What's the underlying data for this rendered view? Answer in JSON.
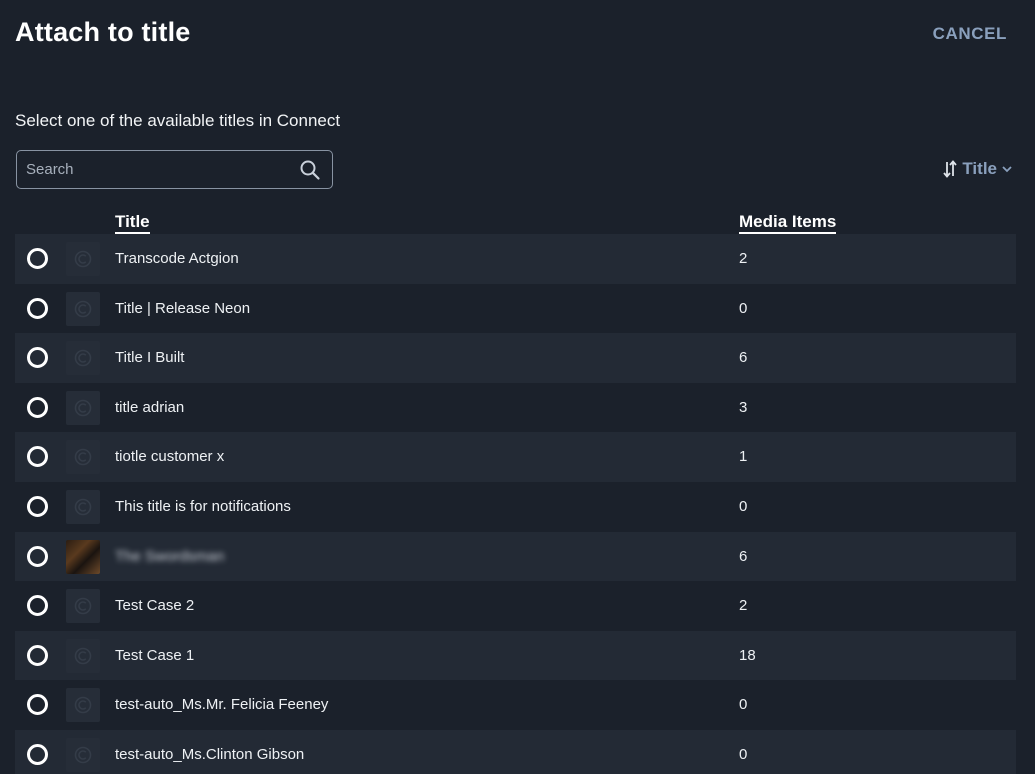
{
  "dialog": {
    "title": "Attach to title",
    "cancel_label": "CANCEL",
    "subtitle": "Select one of the available titles in Connect"
  },
  "search": {
    "placeholder": "Search",
    "value": ""
  },
  "sort": {
    "label": "Title"
  },
  "table": {
    "columns": {
      "title": "Title",
      "media_items": "Media Items"
    },
    "rows": [
      {
        "title": "Transcode Actgion",
        "media_items": "2",
        "thumbnail": "placeholder-icon"
      },
      {
        "title": "Title | Release Neon",
        "media_items": "0",
        "thumbnail": "placeholder-icon"
      },
      {
        "title": "Title I Built",
        "media_items": "6",
        "thumbnail": "placeholder-icon"
      },
      {
        "title": "title adrian",
        "media_items": "3",
        "thumbnail": "placeholder-icon"
      },
      {
        "title": "tiotle customer x",
        "media_items": "1",
        "thumbnail": "placeholder-icon"
      },
      {
        "title": "This title is for notifications",
        "media_items": "0",
        "thumbnail": "placeholder-icon"
      },
      {
        "title": "The Swordsman",
        "media_items": "6",
        "thumbnail": "poster-image",
        "blurred": true
      },
      {
        "title": "Test Case 2",
        "media_items": "2",
        "thumbnail": "placeholder-icon"
      },
      {
        "title": "Test Case 1",
        "media_items": "18",
        "thumbnail": "placeholder-icon"
      },
      {
        "title": "test-auto_Ms.Mr. Felicia Feeney",
        "media_items": "0",
        "thumbnail": "placeholder-icon"
      },
      {
        "title": "test-auto_Ms.Clinton Gibson",
        "media_items": "0",
        "thumbnail": "placeholder-icon"
      }
    ]
  },
  "colors": {
    "background": "#1b212b",
    "row_alt": "#232a35",
    "accent": "#8aa0bd",
    "text": "#eef1f4"
  }
}
